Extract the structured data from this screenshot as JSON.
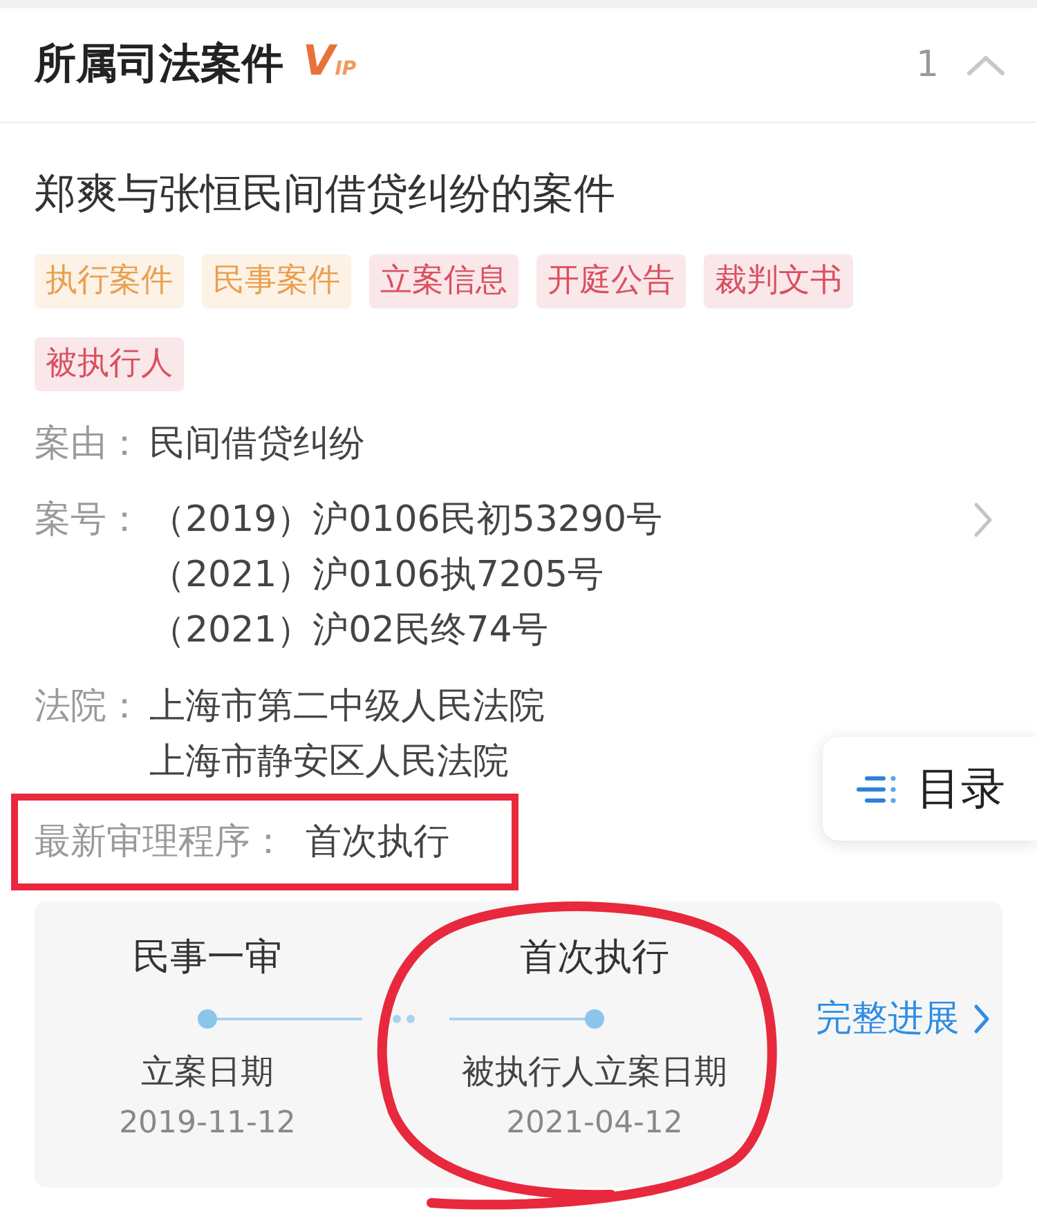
{
  "header": {
    "title": "所属司法案件",
    "badge": "VIP",
    "count": "1",
    "expanded": true
  },
  "case": {
    "title": "郑爽与张恒民间借贷纠纷的案件",
    "tags": [
      {
        "label": "执行案件",
        "color": "#e9a04f"
      },
      {
        "label": "民事案件",
        "color": "#e9a04f"
      },
      {
        "label": "立案信息",
        "color": "#d9505f"
      },
      {
        "label": "开庭公告",
        "color": "#d9505f"
      },
      {
        "label": "裁判文书",
        "color": "#d9505f"
      },
      {
        "label": "被执行人",
        "color": "#d9505f"
      }
    ],
    "fields": [
      {
        "label": "案由：",
        "values": [
          "民间借贷纠纷"
        ],
        "navigable": false
      },
      {
        "label": "案号：",
        "values": [
          "（2019）沪0106民初53290号",
          "（2021）沪0106执7205号",
          "（2021）沪02民终74号"
        ],
        "navigable": true
      },
      {
        "label": "法院：",
        "values": [
          "上海市第二中级人民法院",
          "上海市静安区人民法院"
        ],
        "navigable": false
      }
    ],
    "latest_procedure": {
      "label": "最新审理程序：",
      "value": "首次执行",
      "highlighted": true
    }
  },
  "progress": {
    "steps": [
      {
        "stage": "民事一审",
        "event": "立案日期",
        "date": "2019-11-12",
        "circled": false
      },
      {
        "stage": "首次执行",
        "event": "被执行人立案日期",
        "date": "2021-04-12",
        "circled": true
      }
    ],
    "more_link": "完整进展"
  },
  "toc_button": {
    "label": "目录"
  }
}
